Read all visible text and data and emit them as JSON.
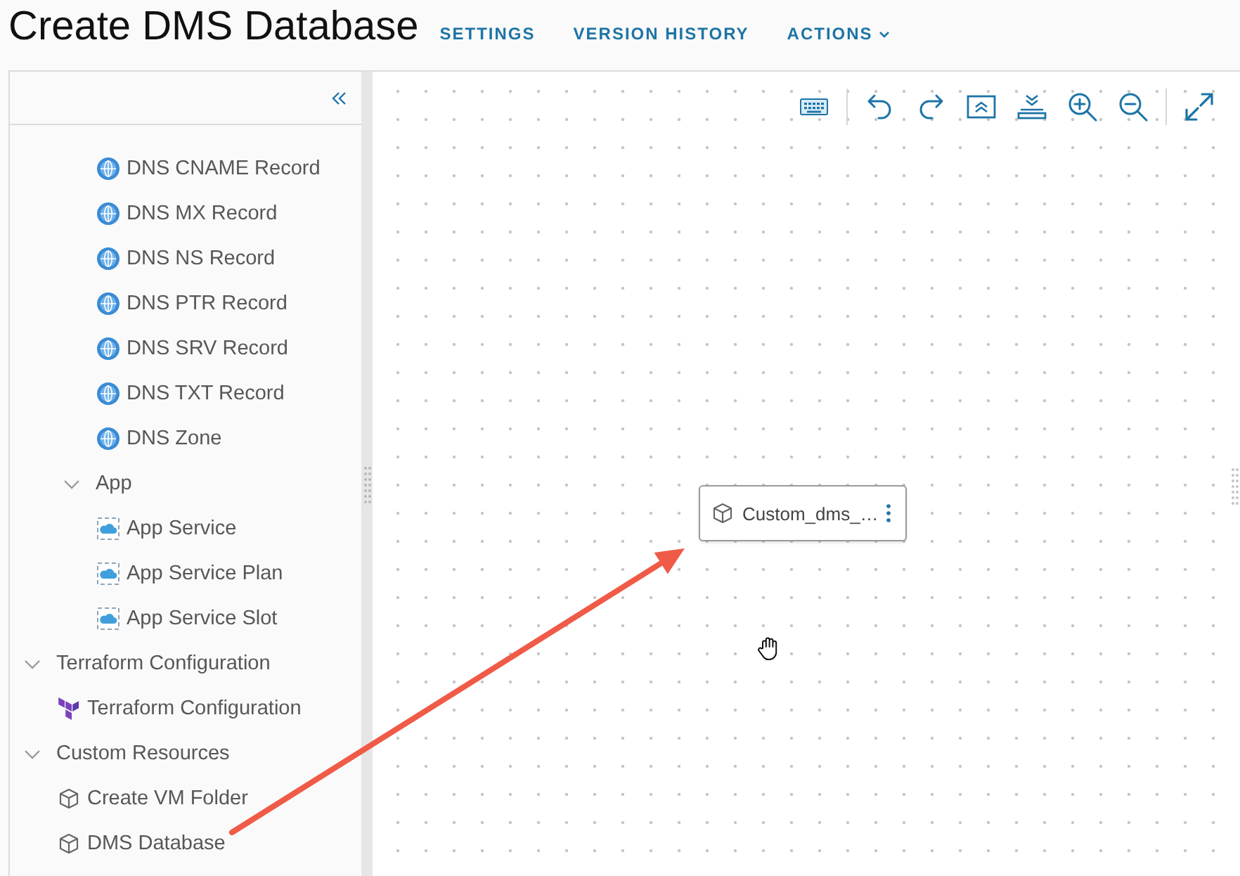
{
  "header": {
    "title": "Create DMS Database",
    "nav": [
      {
        "label": "SETTINGS",
        "kind": "link"
      },
      {
        "label": "VERSION HISTORY",
        "kind": "link"
      },
      {
        "label": "ACTIONS",
        "kind": "menu"
      }
    ]
  },
  "sidebar": {
    "items": [
      {
        "children": [
          {
            "children": [
              {
                "kind": "dns",
                "label": "DNS CNAME Record"
              },
              {
                "kind": "dns",
                "label": "DNS MX Record"
              },
              {
                "kind": "dns",
                "label": "DNS NS Record"
              },
              {
                "kind": "dns",
                "label": "DNS PTR Record"
              },
              {
                "kind": "dns",
                "label": "DNS SRV Record"
              },
              {
                "kind": "dns",
                "label": "DNS TXT Record"
              },
              {
                "kind": "dns",
                "label": "DNS Zone"
              }
            ]
          },
          {
            "kind": "group",
            "label": "App",
            "expanded": true,
            "children": [
              {
                "kind": "app",
                "label": "App Service"
              },
              {
                "kind": "app",
                "label": "App Service Plan"
              },
              {
                "kind": "app",
                "label": "App Service Slot"
              }
            ]
          }
        ]
      },
      {
        "kind": "group",
        "label": "Terraform Configuration",
        "expanded": true,
        "children": [
          {
            "kind": "terraform",
            "label": "Terraform Configuration"
          }
        ]
      },
      {
        "kind": "group",
        "label": "Custom Resources",
        "expanded": true,
        "children": [
          {
            "kind": "resource",
            "label": "Create VM Folder"
          },
          {
            "kind": "resource",
            "label": "DMS Database"
          }
        ]
      }
    ]
  },
  "canvas": {
    "nodes": [
      {
        "label": "Custom_dms_…"
      }
    ]
  }
}
